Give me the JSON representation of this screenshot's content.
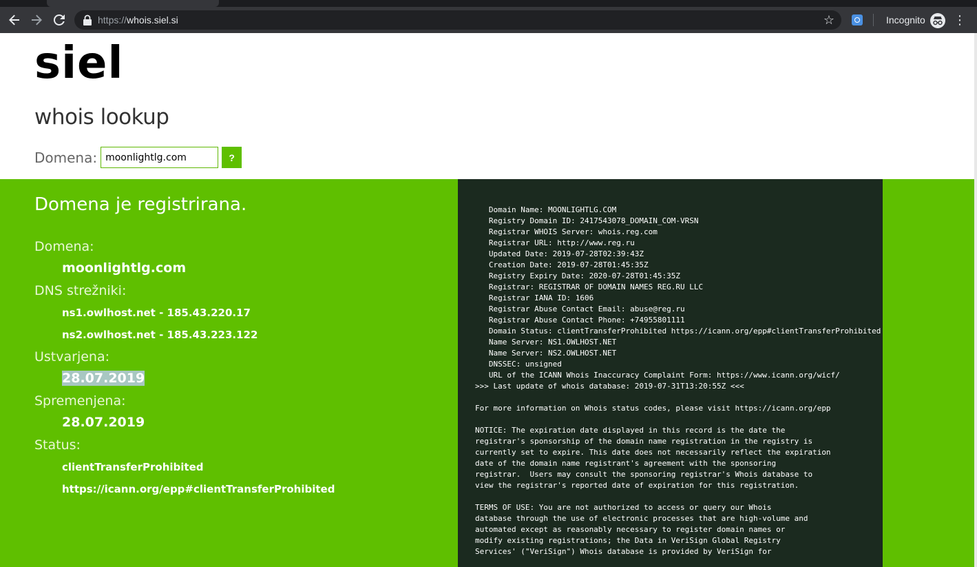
{
  "browser": {
    "url_scheme": "https://",
    "url_host": "whois.siel.si",
    "incognito_label": "Incognito",
    "icons": [
      "back-arrow-icon",
      "forward-arrow-icon",
      "reload-icon",
      "lock-icon",
      "star-icon",
      "extension-icon",
      "incognito-icon",
      "menu-dots-icon"
    ]
  },
  "header": {
    "logo": "siel",
    "title": "whois lookup"
  },
  "search": {
    "label": "Domena:",
    "value": "moonlightlg.com",
    "button_label": "?"
  },
  "result": {
    "heading": "Domena je registrirana.",
    "domain_label": "Domena:",
    "domain": "moonlightlg.com",
    "dns_label": "DNS strežniki:",
    "dns_servers": [
      "ns1.owlhost.net - 185.43.220.17",
      "ns2.owlhost.net - 185.43.223.122"
    ],
    "created_label": "Ustvarjena:",
    "created": "28.07.2019",
    "modified_label": "Spremenjena:",
    "modified": "28.07.2019",
    "status_label": "Status:",
    "statuses": [
      "clientTransferProhibited",
      "https://icann.org/epp#clientTransferProhibited"
    ]
  },
  "raw_whois": "   Domain Name: MOONLIGHTLG.COM\n   Registry Domain ID: 2417543078_DOMAIN_COM-VRSN\n   Registrar WHOIS Server: whois.reg.com\n   Registrar URL: http://www.reg.ru\n   Updated Date: 2019-07-28T02:39:43Z\n   Creation Date: 2019-07-28T01:45:35Z\n   Registry Expiry Date: 2020-07-28T01:45:35Z\n   Registrar: REGISTRAR OF DOMAIN NAMES REG.RU LLC\n   Registrar IANA ID: 1606\n   Registrar Abuse Contact Email: abuse@reg.ru\n   Registrar Abuse Contact Phone: +74955801111\n   Domain Status: clientTransferProhibited https://icann.org/epp#clientTransferProhibited\n   Name Server: NS1.OWLHOST.NET\n   Name Server: NS2.OWLHOST.NET\n   DNSSEC: unsigned\n   URL of the ICANN Whois Inaccuracy Complaint Form: https://www.icann.org/wicf/\n>>> Last update of whois database: 2019-07-31T13:20:55Z <<<\n\nFor more information on Whois status codes, please visit https://icann.org/epp\n\nNOTICE: The expiration date displayed in this record is the date the\nregistrar's sponsorship of the domain name registration in the registry is\ncurrently set to expire. This date does not necessarily reflect the expiration\ndate of the domain name registrant's agreement with the sponsoring\nregistrar.  Users may consult the sponsoring registrar's Whois database to\nview the registrar's reported date of expiration for this registration.\n\nTERMS OF USE: You are not authorized to access or query our Whois\ndatabase through the use of electronic processes that are high-volume and\nautomated except as reasonably necessary to register domain names or\nmodify existing registrations; the Data in VeriSign Global Registry\nServices' (\"VeriSign\") Whois database is provided by VeriSign for"
}
